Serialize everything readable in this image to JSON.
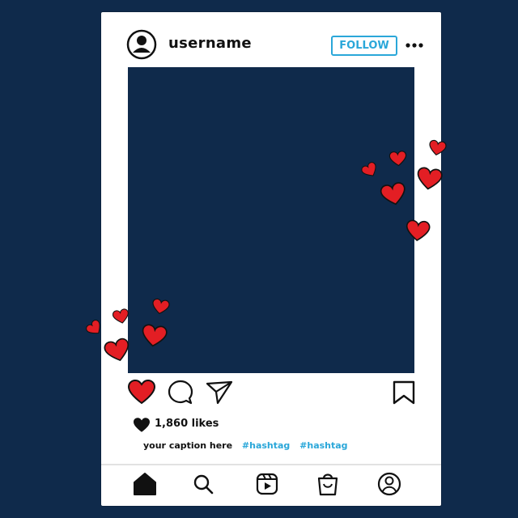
{
  "post": {
    "username": "username",
    "follow_label": "FOLLOW",
    "likes": "1,860 likes",
    "caption": "your caption here",
    "hashtags": [
      "#hashtag",
      "#hashtag"
    ]
  },
  "colors": {
    "background": "#0f2a4b",
    "frame": "#ffffff",
    "accent": "#2aa7d9",
    "heart": "#e31e24"
  },
  "icons": {
    "header": [
      "avatar-icon",
      "more-icon"
    ],
    "actions": [
      "heart-icon",
      "comment-icon",
      "share-icon",
      "bookmark-icon"
    ],
    "nav": [
      "home-icon",
      "search-icon",
      "reels-icon",
      "shop-icon",
      "profile-icon"
    ]
  }
}
